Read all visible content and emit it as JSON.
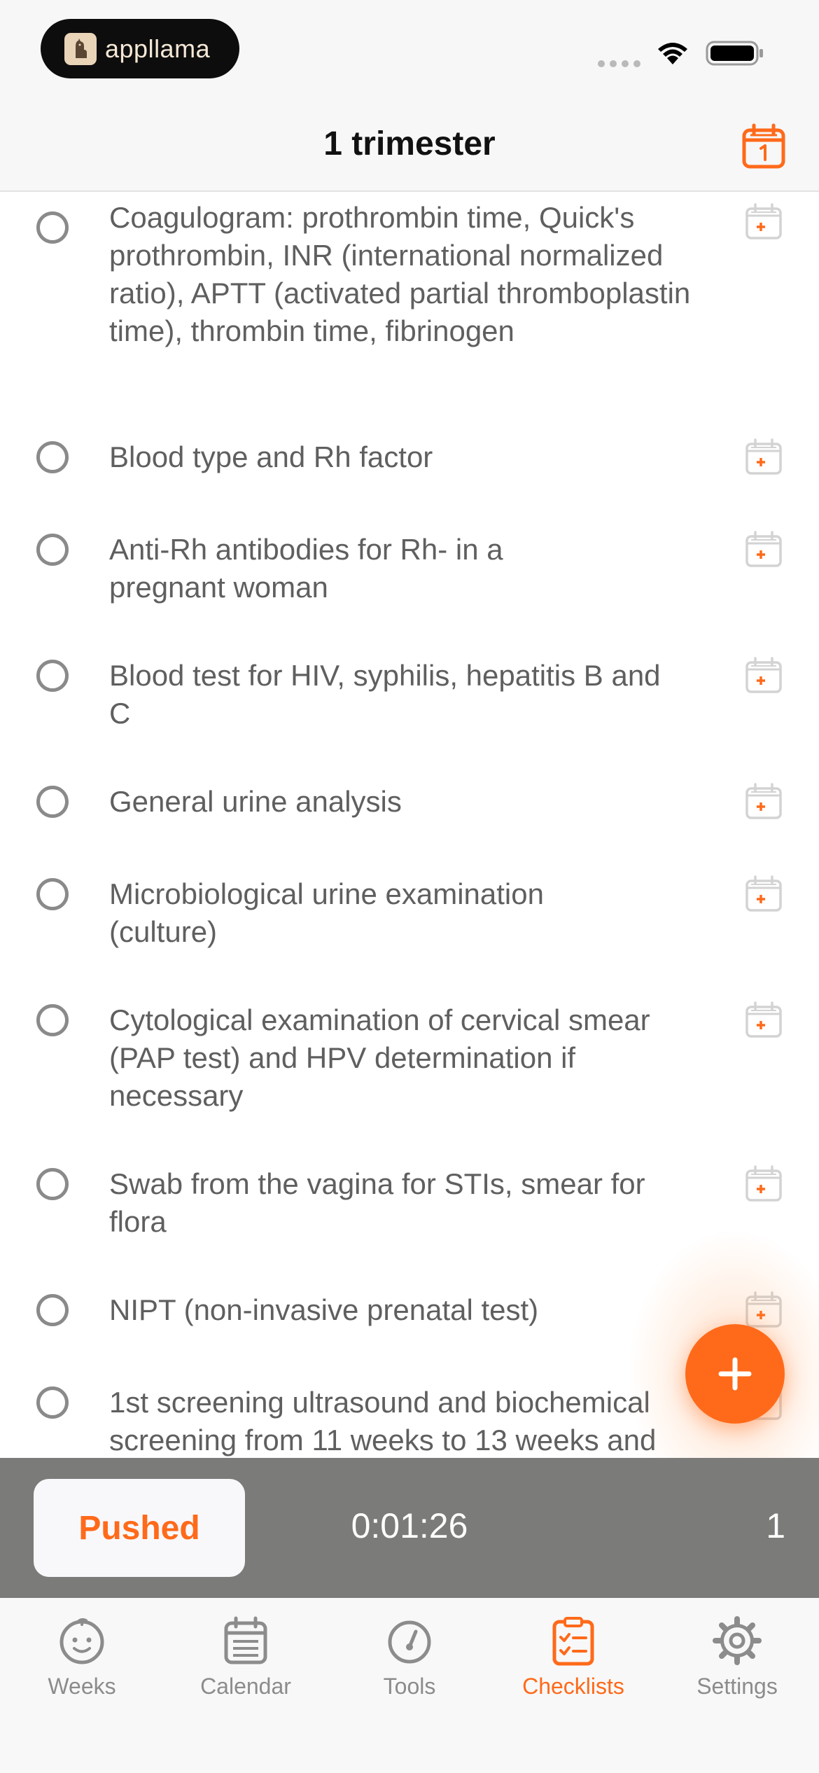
{
  "status_bar": {
    "brand": "appllama"
  },
  "nav": {
    "title": "1 trimester"
  },
  "checklist": [
    {
      "label": "Coagulogram: prothrombin time, Quick's prothrombin, INR (international normalized ratio), APTT (activated partial thromboplastin time), thrombin time, fibrinogen",
      "checked": false
    },
    {
      "label": "Blood type and Rh factor",
      "checked": false
    },
    {
      "label": "Anti-Rh antibodies for Rh- in a pregnant woman",
      "checked": false
    },
    {
      "label": "Blood test for HIV, syphilis, hepatitis B and C",
      "checked": false
    },
    {
      "label": "General urine analysis",
      "checked": false
    },
    {
      "label": "Microbiological urine examination (culture)",
      "checked": false
    },
    {
      "label": "Cytological examination of cervical smear (PAP test) and HPV determination if necessary",
      "checked": false
    },
    {
      "label": "Swab from the vagina for STIs, smear for flora",
      "checked": false
    },
    {
      "label": "NIPT (non-invasive prenatal test)",
      "checked": false
    },
    {
      "label": "1st screening ultrasound and biochemical screening from 11 weeks to 13 weeks and",
      "checked": false
    }
  ],
  "timer": {
    "button_label": "Pushed",
    "elapsed": "0:01:26",
    "count": "1"
  },
  "tabs": [
    {
      "label": "Weeks",
      "icon": "baby-face-icon",
      "active": false
    },
    {
      "label": "Calendar",
      "icon": "calendar-icon",
      "active": false
    },
    {
      "label": "Tools",
      "icon": "gauge-icon",
      "active": false
    },
    {
      "label": "Checklists",
      "icon": "checklist-icon",
      "active": true
    },
    {
      "label": "Settings",
      "icon": "gear-icon",
      "active": false
    }
  ],
  "colors": {
    "accent": "#ff6a1a",
    "timer_bar": "#7b7b79",
    "text": "#5f5f5f"
  }
}
